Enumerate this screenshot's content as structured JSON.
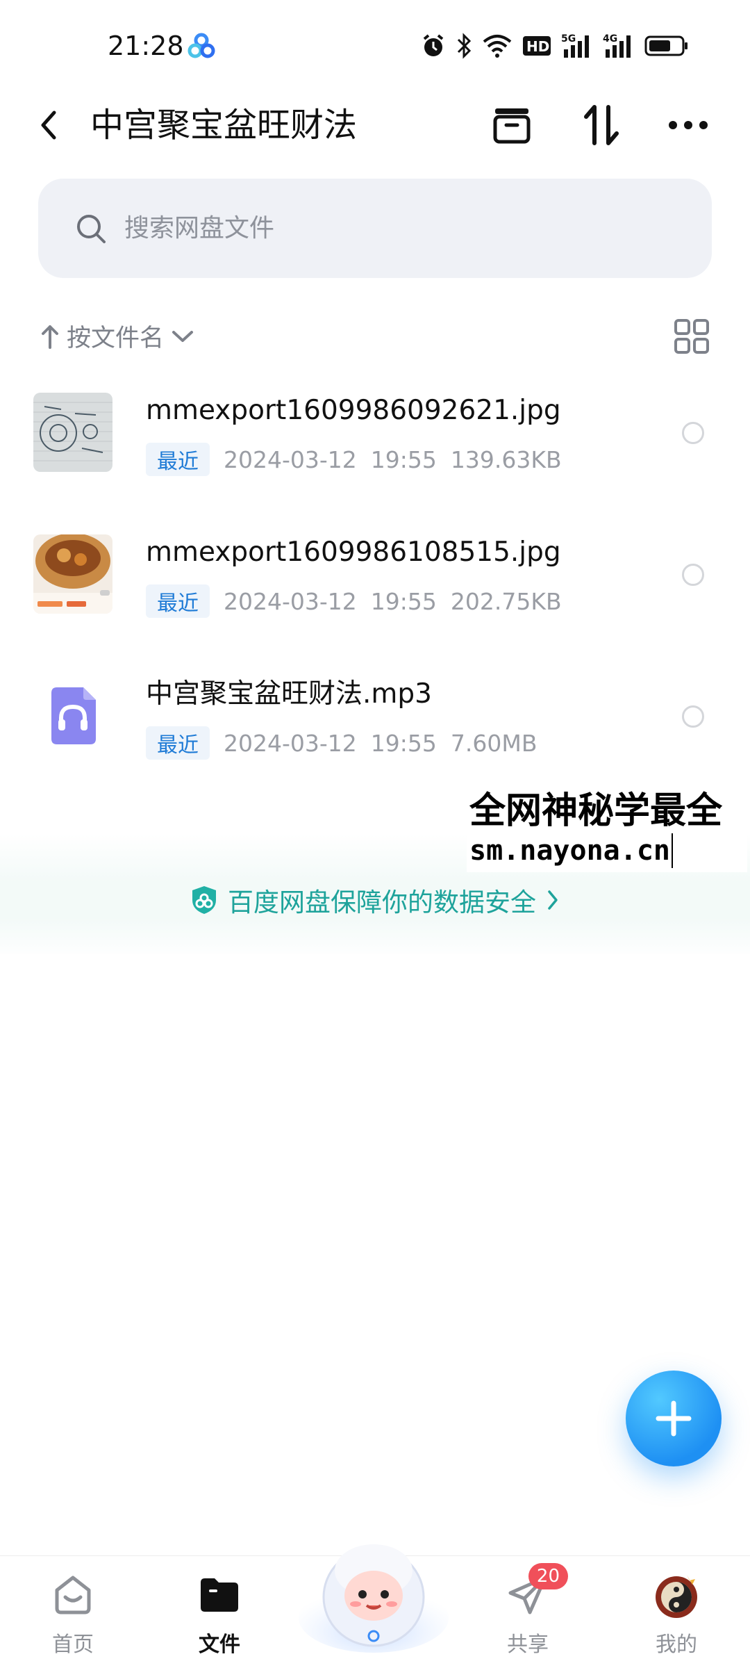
{
  "status_bar": {
    "time": "21:28",
    "icons": [
      "baidu-netdisk-icon",
      "alarm-icon",
      "bluetooth-icon",
      "wifi-icon",
      "hd-icon",
      "5g-signal-icon",
      "4g-signal-icon",
      "battery-icon"
    ],
    "hd": "HD",
    "net_5g": "5G",
    "net_4g": "4G"
  },
  "header": {
    "title": "中宫聚宝盆旺财法",
    "actions": [
      "archive-icon",
      "sort-swap-icon",
      "more-icon"
    ]
  },
  "search": {
    "placeholder": "搜索网盘文件"
  },
  "sort": {
    "label": "按文件名"
  },
  "files": [
    {
      "name": "mmexport1609986092621.jpg",
      "badge": "最近",
      "date": "2024-03-12",
      "time": "19:55",
      "size": "139.63KB",
      "thumb": "image-thumbnail"
    },
    {
      "name": "mmexport1609986108515.jpg",
      "badge": "最近",
      "date": "2024-03-12",
      "time": "19:55",
      "size": "202.75KB",
      "thumb": "image-thumbnail"
    },
    {
      "name": "中宫聚宝盆旺财法.mp3",
      "badge": "最近",
      "date": "2024-03-12",
      "time": "19:55",
      "size": "7.60MB",
      "thumb": "audio-file-icon"
    }
  ],
  "watermark": {
    "line1": "全网神秘学最全",
    "line2": "sm.nayona.cn"
  },
  "security": {
    "text": "百度网盘保障你的数据安全",
    "color": "#1ea39b"
  },
  "nav": {
    "home": "首页",
    "files": "文件",
    "share": "共享",
    "share_badge": "20",
    "mine": "我的"
  },
  "colors": {
    "accent": "#1e90f3",
    "badge_text": "#1f7bd6",
    "notify": "#f0505a"
  }
}
